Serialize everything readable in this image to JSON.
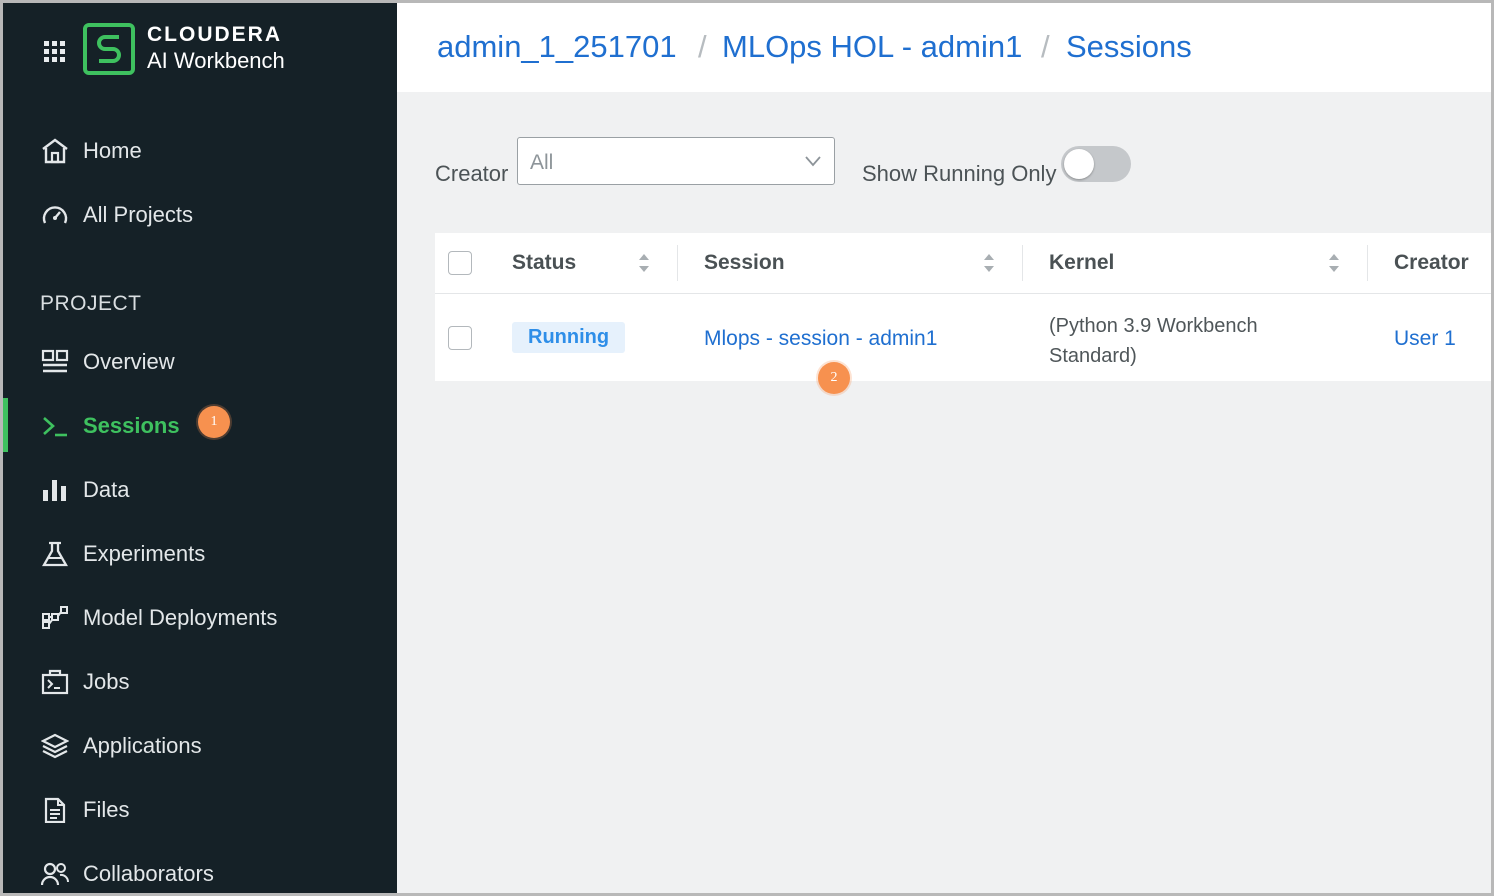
{
  "brand": {
    "line1": "CLOUDERA",
    "line2": "AI Workbench"
  },
  "colors": {
    "sidebar_bg": "#152127",
    "accent_green": "#3ec15f",
    "link_blue": "#1f6fd0",
    "badge_orange": "#f7914f"
  },
  "sidebar": {
    "top_items": [
      {
        "label": "Home",
        "icon": "home-icon"
      },
      {
        "label": "All Projects",
        "icon": "dashboard-gauge-icon"
      }
    ],
    "section_label": "PROJECT",
    "project_items": [
      {
        "label": "Overview",
        "icon": "overview-icon"
      },
      {
        "label": "Sessions",
        "icon": "terminal-icon",
        "active": true,
        "badge": "1"
      },
      {
        "label": "Data",
        "icon": "bar-chart-icon"
      },
      {
        "label": "Experiments",
        "icon": "flask-icon"
      },
      {
        "label": "Model Deployments",
        "icon": "model-graph-icon"
      },
      {
        "label": "Jobs",
        "icon": "jobs-icon"
      },
      {
        "label": "Applications",
        "icon": "layers-icon"
      },
      {
        "label": "Files",
        "icon": "file-icon"
      },
      {
        "label": "Collaborators",
        "icon": "users-icon"
      }
    ]
  },
  "breadcrumb": [
    "admin_1_251701",
    "MLOps HOL - admin1",
    "Sessions"
  ],
  "breadcrumb_separator": "/",
  "filters": {
    "creator_label": "Creator",
    "creator_value": "All",
    "show_running_label": "Show Running Only",
    "show_running_on": false
  },
  "table": {
    "columns": [
      "Status",
      "Session",
      "Kernel",
      "Creator"
    ],
    "rows": [
      {
        "status": "Running",
        "session": "Mlops - session - admin1",
        "kernel_line1": "(Python 3.9 Workbench",
        "kernel_line2": "Standard)",
        "creator": "User 1",
        "badge": "2"
      }
    ]
  }
}
